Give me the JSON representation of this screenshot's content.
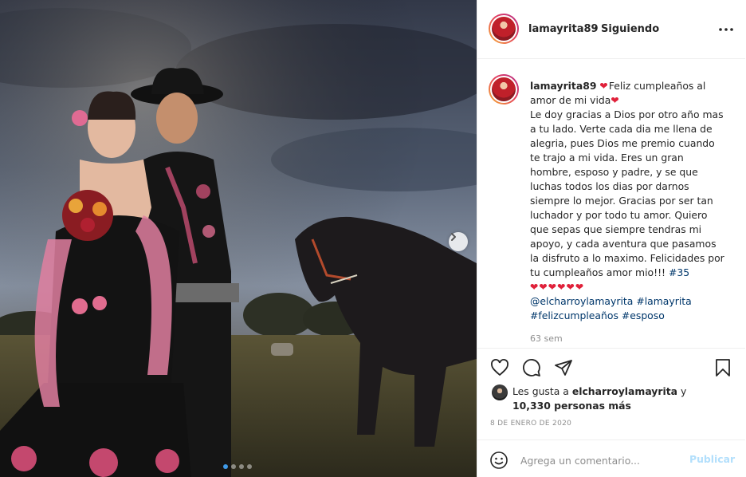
{
  "post": {
    "username": "lamayrita89",
    "separator": "•",
    "follow_state": "Siguiendo",
    "caption": {
      "username": "lamayrita89",
      "line1": "Feliz cumpleaños al amor de mi vida",
      "body": "Le doy gracias a Dios por otro año mas a tu lado. Verte cada dia me llena de alegria, pues Dios me premio cuando te trajo a mi vida. Eres un gran hombre, esposo y padre, y se que luchas todos los dias por darnos siempre lo mejor. Gracias por ser tan luchador y por todo tu amor. Quiero que sepas que siempre tendras mi apoyo, y cada aventura que pasamos la disfruto a lo maximo. Felicidades por tu cumpleaños amor mio!!!",
      "hashtag_35": "#35",
      "hearts": "❤❤❤❤❤❤",
      "mention": "@elcharroylamayrita",
      "hashtag_1": "#lamayrita",
      "hashtag_2": "#felizcumpleaños",
      "hashtag_3": "#esposo"
    },
    "time_ago": "63 sem",
    "likes": {
      "prefix": "Les gusta a",
      "user": "elcharroylamayrita",
      "conj": "y",
      "count": "10,330 personas más"
    },
    "date": "8 DE ENERO DE 2020",
    "comment": {
      "placeholder": "Agrega un comentario...",
      "post_label": "Publicar"
    },
    "carousel": {
      "slides": 4,
      "active_index": 0
    }
  },
  "icons": {
    "more": "more-horizontal-icon",
    "like": "heart-icon",
    "comment": "comment-bubble-icon",
    "share": "paper-plane-icon",
    "save": "bookmark-icon",
    "emoji": "smiley-icon",
    "next": "chevron-right-icon"
  },
  "colors": {
    "link": "#00376b",
    "heart_emoji": "#e0213a",
    "publish_disabled": "#b2dffc",
    "meta_gray": "#8e8e8e"
  }
}
